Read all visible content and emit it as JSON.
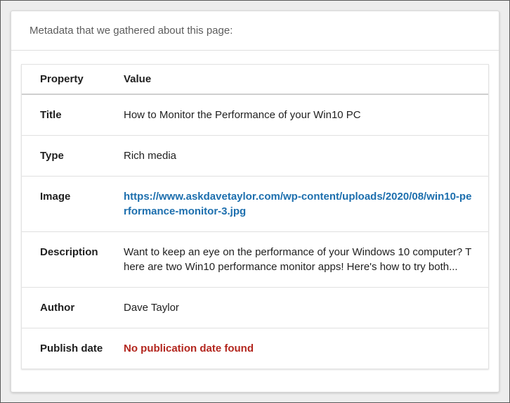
{
  "header": {
    "text": "Metadata that we gathered about this page:"
  },
  "table": {
    "columns": [
      "Property",
      "Value"
    ],
    "rows": [
      {
        "property": "Title",
        "value": "How to Monitor the Performance of your Win10 PC"
      },
      {
        "property": "Type",
        "value": "Rich media"
      },
      {
        "property": "Image",
        "value": "https://www.askdavetaylor.com/wp-content/uploads/2020/08/win10-performance-monitor-3.jpg"
      },
      {
        "property": "Description",
        "value": "Want to keep an eye on the performance of your Windows 10 computer? There are two Win10 performance monitor apps! Here's how to try both..."
      },
      {
        "property": "Author",
        "value": "Dave Taylor"
      },
      {
        "property": "Publish date",
        "value": "No publication date found"
      }
    ]
  },
  "colors": {
    "link": "#1d6fae",
    "error": "#b3261e"
  }
}
